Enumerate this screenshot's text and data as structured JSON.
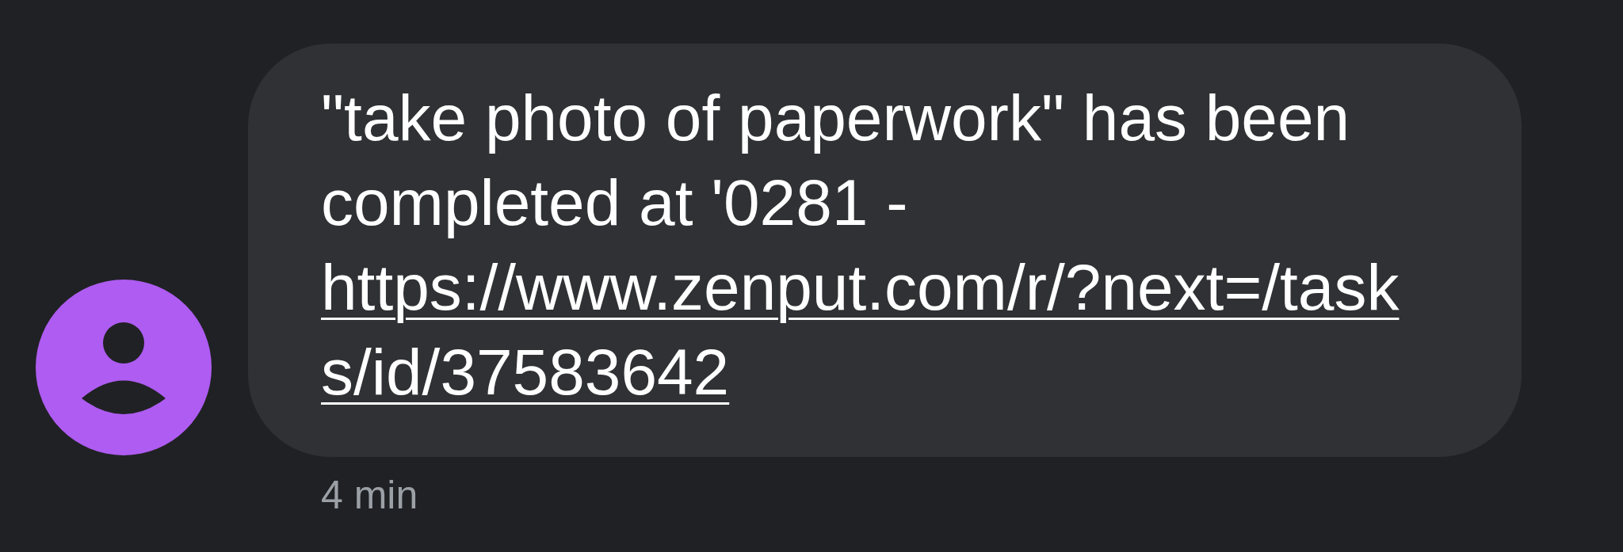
{
  "messages": [
    {
      "text": "\"take photo of paperwork\" has been completed at '0281 - ",
      "link": "https://www.zenput.com/r/?next=/tasks/id/37583642",
      "time": "4 min"
    }
  ]
}
